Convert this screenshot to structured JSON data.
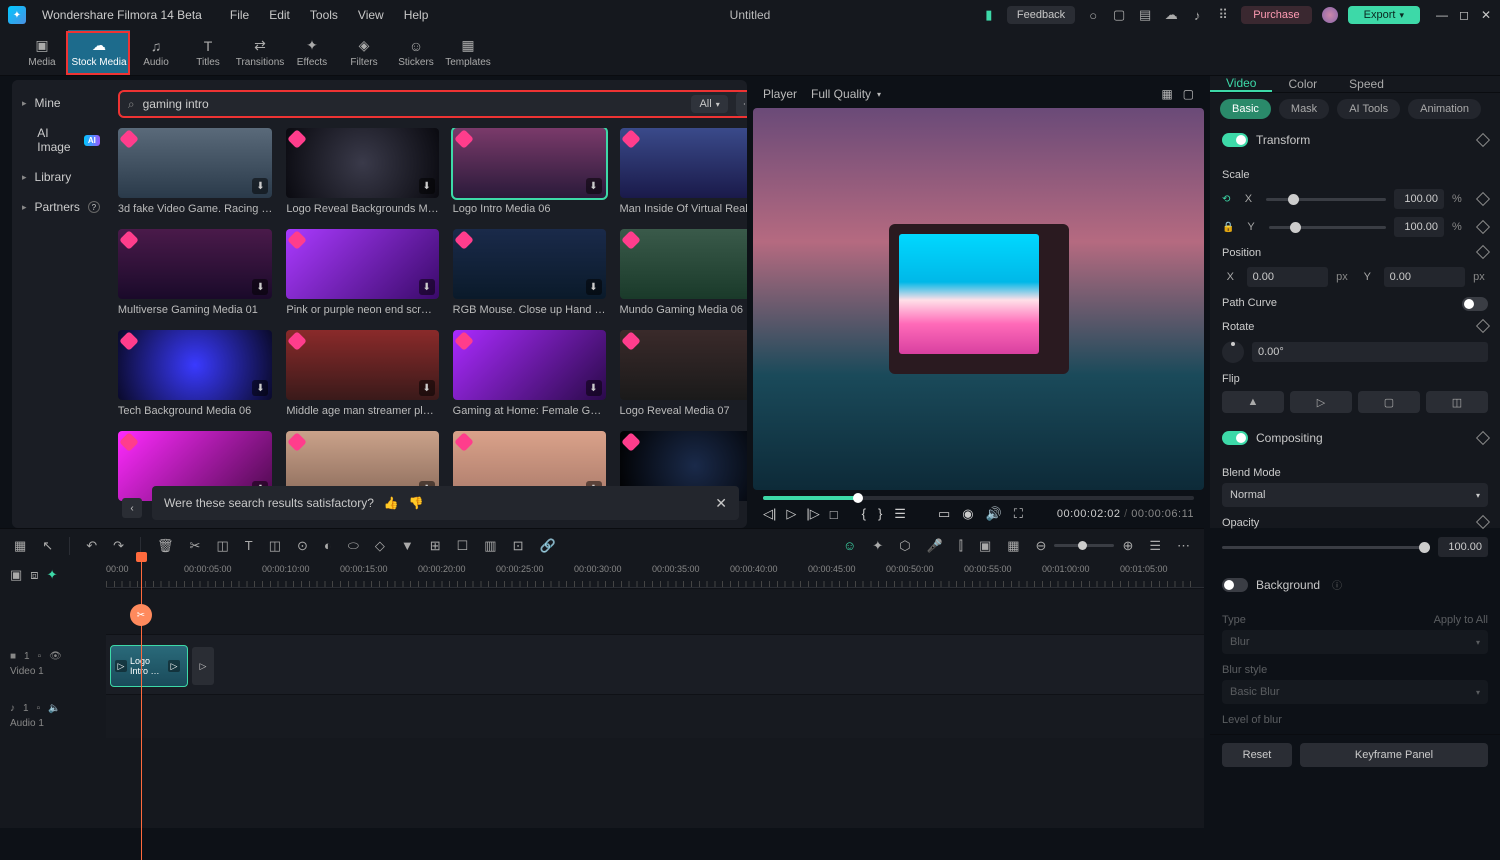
{
  "app": {
    "title": "Wondershare Filmora 14 Beta",
    "doc": "Untitled"
  },
  "menu": [
    "File",
    "Edit",
    "Tools",
    "View",
    "Help"
  ],
  "titlebar_right": {
    "feedback": "Feedback",
    "purchase": "Purchase",
    "export": "Export"
  },
  "top_tabs": [
    "Media",
    "Stock Media",
    "Audio",
    "Titles",
    "Transitions",
    "Effects",
    "Filters",
    "Stickers",
    "Templates"
  ],
  "sidebar": {
    "items": [
      {
        "label": "Mine"
      },
      {
        "label": "AI Image",
        "badge": "AI"
      },
      {
        "label": "Library"
      },
      {
        "label": "Partners",
        "help": true
      }
    ]
  },
  "search": {
    "value": "gaming intro",
    "filter": "All"
  },
  "gallery": [
    {
      "label": "3d fake Video Game. Racing …",
      "th": "th0"
    },
    {
      "label": "Logo Reveal Backgrounds M…",
      "th": "th1"
    },
    {
      "label": "Logo Intro Media 06",
      "th": "th2",
      "selected": true
    },
    {
      "label": "Man Inside Of Virtual Reality…",
      "th": "th3"
    },
    {
      "label": "Multiverse Gaming Media 01",
      "th": "th4"
    },
    {
      "label": "Pink or purple neon end scr…",
      "th": "th5"
    },
    {
      "label": "RGB Mouse. Close up Hand …",
      "th": "th6"
    },
    {
      "label": "Mundo Gaming Media 06",
      "th": "th7"
    },
    {
      "label": "Tech Background Media 06",
      "th": "th8"
    },
    {
      "label": "Middle age man streamer pl…",
      "th": "th9"
    },
    {
      "label": "Gaming at Home: Female G…",
      "th": "th10"
    },
    {
      "label": "Logo Reveal Media 07",
      "th": "th11"
    },
    {
      "label": "",
      "th": "th12"
    },
    {
      "label": "",
      "th": "th13"
    },
    {
      "label": "",
      "th": "th14"
    },
    {
      "label": "",
      "th": "th15"
    }
  ],
  "feedback_row": {
    "text": "Were these search results satisfactory?"
  },
  "player": {
    "label": "Player",
    "quality": "Full Quality",
    "cur": "00:00:02:02",
    "dur": "00:00:06:11"
  },
  "props": {
    "tabs": [
      "Video",
      "Color",
      "Speed"
    ],
    "subtabs": [
      "Basic",
      "Mask",
      "AI Tools",
      "Animation"
    ],
    "transform": {
      "title": "Transform",
      "scale_label": "Scale",
      "scale_x": "100.00",
      "scale_y": "100.00",
      "pct": "%",
      "position_label": "Position",
      "pos_x": "0.00",
      "pos_y": "0.00",
      "px": "px",
      "path_curve": "Path Curve",
      "rotate": "Rotate",
      "rotate_val": "0.00°",
      "flip": "Flip"
    },
    "compositing": {
      "title": "Compositing",
      "blend_label": "Blend Mode",
      "blend": "Normal",
      "opacity_label": "Opacity",
      "opacity": "100.00"
    },
    "background": {
      "title": "Background",
      "type_label": "Type",
      "apply": "Apply to All",
      "type": "Blur",
      "style_label": "Blur style",
      "style": "Basic Blur",
      "level_label": "Level of blur"
    },
    "buttons": {
      "reset": "Reset",
      "keyframe": "Keyframe Panel"
    }
  },
  "timeline": {
    "ticks": [
      "00:00",
      "00:00:05:00",
      "00:00:10:00",
      "00:00:15:00",
      "00:00:20:00",
      "00:00:25:00",
      "00:00:30:00",
      "00:00:35:00",
      "00:00:40:00",
      "00:00:45:00",
      "00:00:50:00",
      "00:00:55:00",
      "00:01:00:00",
      "00:01:05:00"
    ],
    "video_track": "Video 1",
    "audio_track": "Audio 1",
    "clip_label": "Logo Intro …"
  }
}
